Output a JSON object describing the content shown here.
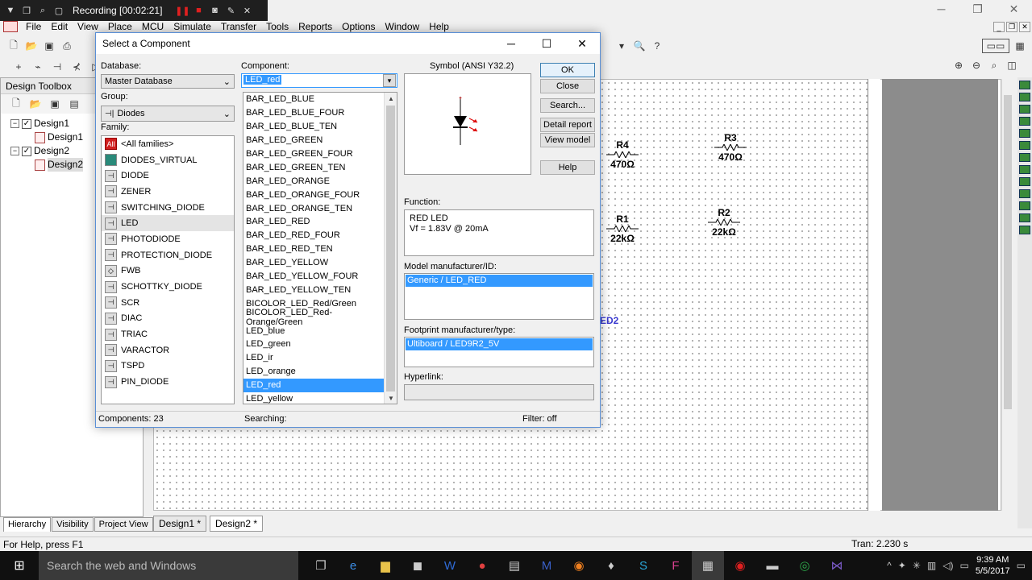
{
  "recorder": {
    "label": "Recording [00:02:21]"
  },
  "menu": [
    "File",
    "Edit",
    "View",
    "Place",
    "MCU",
    "Simulate",
    "Transfer",
    "Tools",
    "Reports",
    "Options",
    "Window",
    "Help"
  ],
  "design_toolbox": {
    "title": "Design Toolbox",
    "tree": [
      {
        "label": "Design1",
        "level": 0
      },
      {
        "label": "Design1",
        "level": 1
      },
      {
        "label": "Design2",
        "level": 0
      },
      {
        "label": "Design2",
        "level": 1
      }
    ],
    "tabs": [
      "Hierarchy",
      "Visibility",
      "Project View"
    ]
  },
  "schematic": {
    "components": [
      {
        "ref": "R4",
        "value": "470Ω"
      },
      {
        "ref": "R3",
        "value": "470Ω"
      },
      {
        "ref": "R1",
        "value": "22kΩ"
      },
      {
        "ref": "R2",
        "value": "22kΩ"
      }
    ],
    "partial_label": "ED2",
    "tabs": [
      "Design1 *",
      "Design2 *"
    ]
  },
  "status": {
    "help": "For Help, press F1",
    "tran": "Tran: 2.230 s"
  },
  "dialog": {
    "title": "Select a Component",
    "database_label": "Database:",
    "database_value": "Master Database",
    "group_label": "Group:",
    "group_value": "Diodes",
    "family_label": "Family:",
    "families": [
      "<All families>",
      "DIODES_VIRTUAL",
      "DIODE",
      "ZENER",
      "SWITCHING_DIODE",
      "LED",
      "PHOTODIODE",
      "PROTECTION_DIODE",
      "FWB",
      "SCHOTTKY_DIODE",
      "SCR",
      "DIAC",
      "TRIAC",
      "VARACTOR",
      "TSPD",
      "PIN_DIODE"
    ],
    "family_icon_all": "All",
    "component_label": "Component:",
    "component_value": "LED_red",
    "components": [
      "BAR_LED_BLUE",
      "BAR_LED_BLUE_FOUR",
      "BAR_LED_BLUE_TEN",
      "BAR_LED_GREEN",
      "BAR_LED_GREEN_FOUR",
      "BAR_LED_GREEN_TEN",
      "BAR_LED_ORANGE",
      "BAR_LED_ORANGE_FOUR",
      "BAR_LED_ORANGE_TEN",
      "BAR_LED_RED",
      "BAR_LED_RED_FOUR",
      "BAR_LED_RED_TEN",
      "BAR_LED_YELLOW",
      "BAR_LED_YELLOW_FOUR",
      "BAR_LED_YELLOW_TEN",
      "BICOLOR_LED_Red/Green",
      "BICOLOR_LED_Red-Orange/Green",
      "LED_blue",
      "LED_green",
      "LED_ir",
      "LED_orange",
      "LED_red",
      "LED_yellow"
    ],
    "selected_component": "LED_red",
    "symbol_label": "Symbol (ANSI Y32.2)",
    "buttons": [
      "OK",
      "Close",
      "Search...",
      "Detail report",
      "View model",
      "Help"
    ],
    "function_label": "Function:",
    "function_lines": [
      "RED LED",
      "Vf = 1.83V @ 20mA"
    ],
    "model_label": "Model manufacturer/ID:",
    "model_value": "Generic / LED_RED",
    "footprint_label": "Footprint manufacturer/type:",
    "footprint_value": "Ultiboard / LED9R2_5V",
    "hyperlink_label": "Hyperlink:",
    "status_components": "Components: 23",
    "status_searching": "Searching:",
    "status_filter": "Filter: off"
  },
  "taskbar": {
    "search_placeholder": "Search the web and Windows",
    "time": "9:39 AM",
    "date": "5/5/2017"
  }
}
